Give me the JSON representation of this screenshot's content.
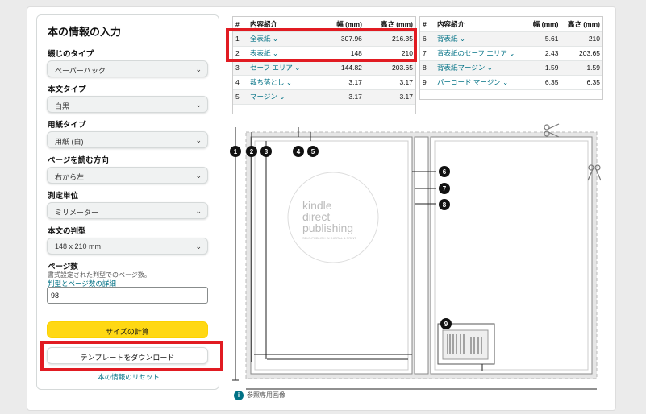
{
  "form": {
    "title": "本の情報の入力",
    "binding": {
      "label": "綴じのタイプ",
      "value": "ペーパーバック"
    },
    "interior": {
      "label": "本文タイプ",
      "value": "白黒"
    },
    "paper": {
      "label": "用紙タイプ",
      "value": "用紙 (白)"
    },
    "reading": {
      "label": "ページを読む方向",
      "value": "右から左"
    },
    "unit": {
      "label": "測定単位",
      "value": "ミリメーター"
    },
    "trim": {
      "label": "本文の判型",
      "value": "148 x 210 mm"
    },
    "pages": {
      "label": "ページ数",
      "note": "書式設定された判型でのページ数。",
      "link": "判型とページ数の詳細",
      "value": "98"
    },
    "calc_button": "サイズの計算",
    "download_button": "テンプレートをダウンロード",
    "reset_link": "本の情報のリセット"
  },
  "table": {
    "headers": {
      "num": "#",
      "item": "内容紹介",
      "width": "幅 (mm)",
      "height": "高さ (mm)"
    },
    "left": [
      {
        "n": "1",
        "name": "全表紙",
        "w": "307.96",
        "h": "216.35"
      },
      {
        "n": "2",
        "name": "表表紙",
        "w": "148",
        "h": "210"
      },
      {
        "n": "3",
        "name": "セーフ エリア",
        "w": "144.82",
        "h": "203.65"
      },
      {
        "n": "4",
        "name": "裁ち落とし",
        "w": "3.17",
        "h": "3.17"
      },
      {
        "n": "5",
        "name": "マージン",
        "w": "3.17",
        "h": "3.17"
      }
    ],
    "right": [
      {
        "n": "6",
        "name": "背表紙",
        "w": "5.61",
        "h": "210"
      },
      {
        "n": "7",
        "name": "背表紙のセーフ エリア",
        "w": "2.43",
        "h": "203.65"
      },
      {
        "n": "8",
        "name": "背表紙マージン",
        "w": "1.59",
        "h": "1.59"
      },
      {
        "n": "9",
        "name": "バーコード マージン",
        "w": "6.35",
        "h": "6.35"
      }
    ]
  },
  "diagram": {
    "logo_line1": "kindle",
    "logo_line2": "direct",
    "logo_line3": "publishing",
    "logo_tag": "SELF-PUBLISH IN DIGITAL & PRINT",
    "markers": [
      "1",
      "2",
      "3",
      "4",
      "5",
      "6",
      "7",
      "8",
      "9"
    ],
    "caption": "参照専用画像",
    "info_icon": "i"
  },
  "colors": {
    "highlight": "#e11b22",
    "accent": "#007185",
    "button": "#ffd814"
  }
}
